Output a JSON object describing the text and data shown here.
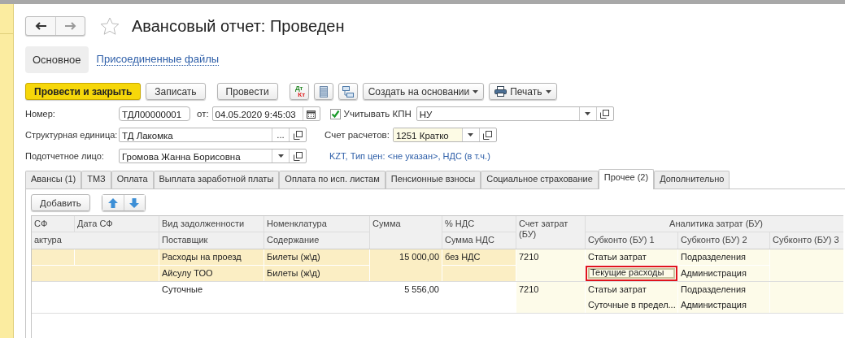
{
  "window": {
    "title": "Авансовый отчет: Проведен",
    "favorite": false
  },
  "sections": [
    {
      "label": "Основное",
      "selected": true
    },
    {
      "label": "Присоединенные файлы",
      "selected": false
    }
  ],
  "toolbar": [
    {
      "kind": "button",
      "label": "Провести и закрыть",
      "default": true
    },
    {
      "kind": "button",
      "label": "Записать",
      "default": false
    },
    {
      "kind": "button",
      "label": "Провести",
      "default": false
    },
    {
      "kind": "dtkt",
      "top": "Дт",
      "bottom": "Кт"
    },
    {
      "kind": "list_button"
    },
    {
      "kind": "structure_button"
    },
    {
      "kind": "menu",
      "label": "Создать на основании"
    },
    {
      "kind": "print_menu",
      "label": "Печать"
    }
  ],
  "form": {
    "number": {
      "label": "Номер:",
      "value": "ТДЛ00000001"
    },
    "date": {
      "label": "от:",
      "value": "04.05.2020  9:45:03"
    },
    "kpn": {
      "label": "Учитывать КПН",
      "checked": true
    },
    "tax_mode": {
      "value": "НУ"
    },
    "unit": {
      "label": "Структурная единица:",
      "value": "ТД Лакомка",
      "select_button": "..."
    },
    "account": {
      "label": "Счет расчетов:",
      "value": "1251 Кратко"
    },
    "person": {
      "label": "Подотчетное лицо:",
      "value": "Громова Жанна Борисовна"
    },
    "currency_link": "KZT, Тип цен: <не указан>, НДС (в т.ч.)"
  },
  "tabs": [
    {
      "label": "Авансы (1)",
      "selected": false
    },
    {
      "label": "ТМЗ",
      "selected": false
    },
    {
      "label": "Оплата",
      "selected": false
    },
    {
      "label": "Выплата заработной платы",
      "selected": false
    },
    {
      "label": "Оплата по исп. листам",
      "selected": false
    },
    {
      "label": "Пенсионные взносы",
      "selected": false
    },
    {
      "label": "Социальное страхование",
      "selected": false
    },
    {
      "label": "Прочее (2)",
      "selected": true
    },
    {
      "label": "Дополнительно",
      "selected": false
    }
  ],
  "table_toolbar": {
    "add": "Добавить"
  },
  "table": {
    "header": {
      "sf": "СФ",
      "sf_date": "Дата СФ",
      "debt_type": "Вид задолженности",
      "item": "Номенклатура",
      "amount": "Сумма",
      "vat_rate": "% НДС",
      "cost_account": "Счет затрат (БУ)",
      "analytics": "Аналитика затрат (БУ)",
      "invoice": "актура",
      "supplier": "Поставщик",
      "content": "Содержание",
      "vat_amount": "Сумма НДС",
      "subconto_1": "Субконто (БУ) 1",
      "subconto_2": "Субконто (БУ) 2",
      "subconto_3": "Субконто (БУ) 3"
    },
    "rows": [
      {
        "selected": true,
        "highlighted": true,
        "cells": {
          "debt_type": "Расходы на проезд",
          "supplier": "Айсулу ТОО",
          "item": "Билеты (ж\\д)",
          "content": "Билеты (ж\\д)",
          "amount": "15 000,00",
          "vat_rate": "без НДС",
          "cost_account": "7210",
          "subconto_1": "Статьи затрат",
          "subconto_1_value": "Текущие расходы",
          "subconto_2": "Подразделения",
          "subconto_2_value": "Администрация"
        }
      },
      {
        "selected": false,
        "cells": {
          "debt_type": "Суточные",
          "amount": "5 556,00",
          "cost_account": "7210",
          "subconto_1": "Статьи затрат",
          "subconto_1_value": "Суточные в предел...",
          "subconto_2": "Подразделения",
          "subconto_2_value": "Администрация"
        }
      }
    ]
  }
}
